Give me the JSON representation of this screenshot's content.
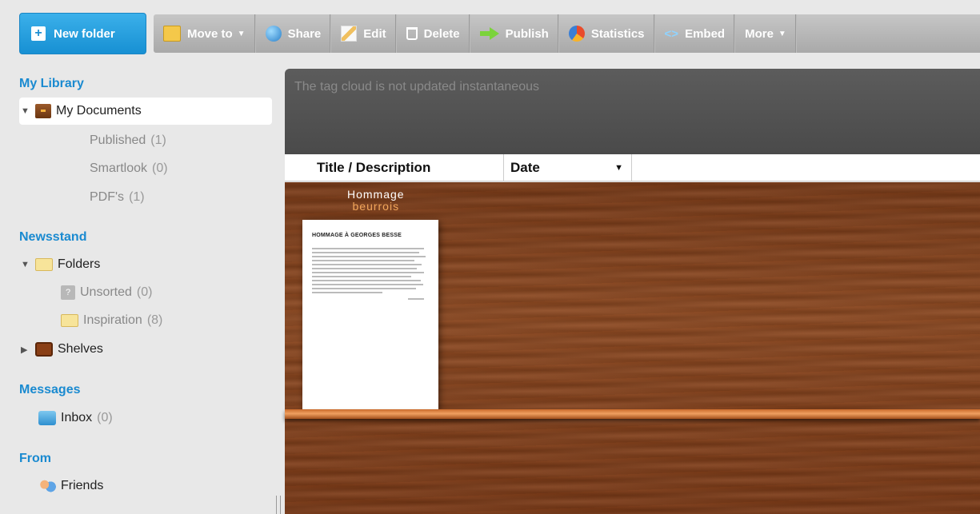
{
  "toolbar": {
    "new_folder": "New folder",
    "move_to": "Move to",
    "share": "Share",
    "edit": "Edit",
    "delete": "Delete",
    "publish": "Publish",
    "statistics": "Statistics",
    "embed": "Embed",
    "more": "More"
  },
  "sidebar": {
    "my_library": {
      "title": "My Library",
      "my_documents": "My Documents",
      "published": "Published",
      "published_count": "(1)",
      "smartlook": "Smartlook",
      "smartlook_count": "(0)",
      "pdfs": "PDF's",
      "pdfs_count": "(1)"
    },
    "newsstand": {
      "title": "Newsstand",
      "folders": "Folders",
      "unsorted": "Unsorted",
      "unsorted_count": "(0)",
      "inspiration": "Inspiration",
      "inspiration_count": "(8)",
      "shelves": "Shelves"
    },
    "messages": {
      "title": "Messages",
      "inbox": "Inbox",
      "inbox_count": "(0)"
    },
    "from": {
      "title": "From",
      "friends": "Friends"
    }
  },
  "main": {
    "notice": "The tag cloud is not updated instantaneous",
    "columns": {
      "title": "Title / Description",
      "date": "Date"
    },
    "document": {
      "title": "Hommage",
      "author": "beurrois",
      "cover_heading": "HOMMAGE À GEORGES BESSE"
    }
  },
  "colors": {
    "accent": "#1a8ad0",
    "new_folder_bg": "#2aa3e2",
    "toolbar_bg": "#b5b5b5",
    "notice_bg": "#555555",
    "wood": "#84421d"
  }
}
